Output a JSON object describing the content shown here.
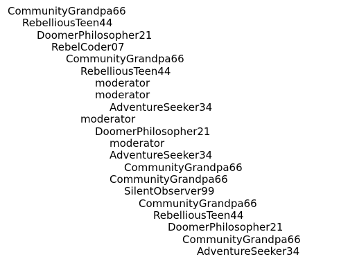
{
  "thread": {
    "nodes": [
      {
        "user": "CommunityGrandpa66",
        "depth": 0
      },
      {
        "user": "RebelliousTeen44",
        "depth": 1
      },
      {
        "user": "DoomerPhilosopher21",
        "depth": 2
      },
      {
        "user": "RebelCoder07",
        "depth": 3
      },
      {
        "user": "CommunityGrandpa66",
        "depth": 4
      },
      {
        "user": "RebelliousTeen44",
        "depth": 5
      },
      {
        "user": "moderator",
        "depth": 6
      },
      {
        "user": "moderator",
        "depth": 6
      },
      {
        "user": "AdventureSeeker34",
        "depth": 7
      },
      {
        "user": "moderator",
        "depth": 5
      },
      {
        "user": "DoomerPhilosopher21",
        "depth": 6
      },
      {
        "user": "moderator",
        "depth": 7
      },
      {
        "user": "AdventureSeeker34",
        "depth": 7
      },
      {
        "user": "CommunityGrandpa66",
        "depth": 8
      },
      {
        "user": "CommunityGrandpa66",
        "depth": 7
      },
      {
        "user": "SilentObserver99",
        "depth": 8
      },
      {
        "user": "CommunityGrandpa66",
        "depth": 9
      },
      {
        "user": "RebelliousTeen44",
        "depth": 10
      },
      {
        "user": "DoomerPhilosopher21",
        "depth": 11
      },
      {
        "user": "CommunityGrandpa66",
        "depth": 12
      },
      {
        "user": "AdventureSeeker34",
        "depth": 13
      }
    ]
  }
}
